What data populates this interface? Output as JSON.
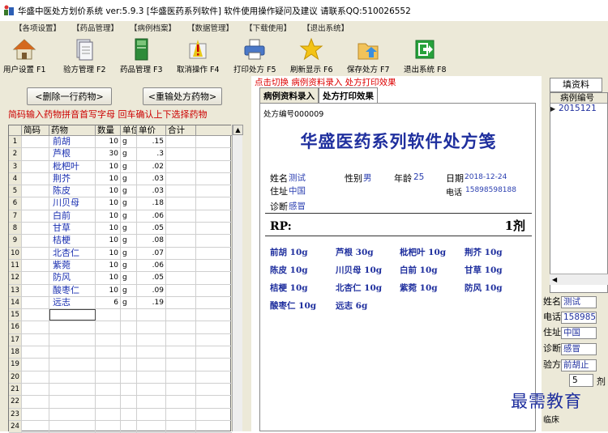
{
  "window": {
    "title": "华盛中医处方划价系统 ver:5.9.3 [华盛医药系列软件]   软件使用操作疑问及建议 请联系QQ:510026552"
  },
  "menu": [
    "【各项设置】",
    "【药品管理】",
    "【病例档案】",
    "【数据管理】",
    "【下载使用】",
    "【退出系统】"
  ],
  "toolbar": [
    {
      "label": "用户设置 F1",
      "icon": "home-icon"
    },
    {
      "label": "验方管理 F2",
      "icon": "document-icon"
    },
    {
      "label": "药品管理 F3",
      "icon": "book-icon"
    },
    {
      "label": "取消操作 F4",
      "icon": "warning-icon"
    },
    {
      "label": "打印处方 F5",
      "icon": "printer-icon"
    },
    {
      "label": "刷新显示 F6",
      "icon": "star-icon"
    },
    {
      "label": "保存处方 F7",
      "icon": "folder-icon"
    },
    {
      "label": "退出系统 F8",
      "icon": "exit-icon"
    }
  ],
  "hint": "点击切换 病例资料录入 处方打印效果",
  "left": {
    "delete_button": "<删除一行药物>",
    "reenter_button": "<重输处方药物>",
    "tip": "简码输入药物拼音首写字母  回车确认上下选择药物",
    "columns": [
      "简码",
      "药物",
      "数量",
      "单位",
      "单价",
      "合计"
    ],
    "rows": [
      {
        "n": "1",
        "code": "",
        "name": "前胡",
        "qty": "10",
        "unit": "g",
        "price": ".15",
        "total": ""
      },
      {
        "n": "2",
        "code": "",
        "name": "芦根",
        "qty": "30",
        "unit": "g",
        "price": ".3",
        "total": ""
      },
      {
        "n": "3",
        "code": "",
        "name": "枇杷叶",
        "qty": "10",
        "unit": "g",
        "price": ".02",
        "total": ""
      },
      {
        "n": "4",
        "code": "",
        "name": "荆芥",
        "qty": "10",
        "unit": "g",
        "price": ".03",
        "total": ""
      },
      {
        "n": "5",
        "code": "",
        "name": "陈皮",
        "qty": "10",
        "unit": "g",
        "price": ".03",
        "total": ""
      },
      {
        "n": "6",
        "code": "",
        "name": "川贝母",
        "qty": "10",
        "unit": "g",
        "price": ".18",
        "total": ""
      },
      {
        "n": "7",
        "code": "",
        "name": "白前",
        "qty": "10",
        "unit": "g",
        "price": ".06",
        "total": ""
      },
      {
        "n": "8",
        "code": "",
        "name": "甘草",
        "qty": "10",
        "unit": "g",
        "price": ".05",
        "total": ""
      },
      {
        "n": "9",
        "code": "",
        "name": "桔梗",
        "qty": "10",
        "unit": "g",
        "price": ".08",
        "total": ""
      },
      {
        "n": "10",
        "code": "",
        "name": "北杏仁",
        "qty": "10",
        "unit": "g",
        "price": ".07",
        "total": ""
      },
      {
        "n": "11",
        "code": "",
        "name": "紫菀",
        "qty": "10",
        "unit": "g",
        "price": ".06",
        "total": ""
      },
      {
        "n": "12",
        "code": "",
        "name": "防风",
        "qty": "10",
        "unit": "g",
        "price": ".05",
        "total": ""
      },
      {
        "n": "13",
        "code": "",
        "name": "酸枣仁",
        "qty": "10",
        "unit": "g",
        "price": ".09",
        "total": ""
      },
      {
        "n": "14",
        "code": "",
        "name": "远志",
        "qty": "6",
        "unit": "g",
        "price": ".19",
        "total": ""
      },
      {
        "n": "15",
        "code": "",
        "name": "",
        "qty": "",
        "unit": "",
        "price": "",
        "total": ""
      },
      {
        "n": "16",
        "code": "",
        "name": "",
        "qty": "",
        "unit": "",
        "price": "",
        "total": ""
      },
      {
        "n": "17",
        "code": "",
        "name": "",
        "qty": "",
        "unit": "",
        "price": "",
        "total": ""
      },
      {
        "n": "18",
        "code": "",
        "name": "",
        "qty": "",
        "unit": "",
        "price": "",
        "total": ""
      },
      {
        "n": "19",
        "code": "",
        "name": "",
        "qty": "",
        "unit": "",
        "price": "",
        "total": ""
      },
      {
        "n": "20",
        "code": "",
        "name": "",
        "qty": "",
        "unit": "",
        "price": "",
        "total": ""
      },
      {
        "n": "21",
        "code": "",
        "name": "",
        "qty": "",
        "unit": "",
        "price": "",
        "total": ""
      },
      {
        "n": "22",
        "code": "",
        "name": "",
        "qty": "",
        "unit": "",
        "price": "",
        "total": ""
      },
      {
        "n": "23",
        "code": "",
        "name": "",
        "qty": "",
        "unit": "",
        "price": "",
        "total": ""
      },
      {
        "n": "24",
        "code": "",
        "name": "",
        "qty": "",
        "unit": "",
        "price": "",
        "total": ""
      }
    ],
    "scroll_up": "▲"
  },
  "tabs": [
    "病例资料录入",
    "处方打印效果"
  ],
  "prescription": {
    "serial_label": "处方编号",
    "serial": "000009",
    "title": "华盛医药系列软件处方笺",
    "name_label": "姓名",
    "name": "测试",
    "sex_label": "性别",
    "sex": "男",
    "age_label": "年龄",
    "age": "25",
    "date_label": "日期",
    "date": "2018-12-24",
    "addr_label": "住址",
    "addr": "中国",
    "phone_label": "电话",
    "phone": "15898598188",
    "diag_label": "诊断",
    "diag": "感冒",
    "rp": "RP:",
    "doses": "1剂",
    "herbs": [
      "前胡 10g",
      "芦根 30g",
      "枇杷叶 10g",
      "荆芥 10g",
      "陈皮 10g",
      "川贝母 10g",
      "白前 10g",
      "甘草 10g",
      "桔梗 10g",
      "北杏仁 10g",
      "紫菀 10g",
      "防风 10g",
      "酸枣仁 10g",
      "远志 6g"
    ]
  },
  "right": {
    "tab": "填资料",
    "list_header": "病例编号",
    "list_row": "2015121",
    "scroll_left": "◀",
    "name_label": "姓名",
    "name": "测试",
    "phone_label": "电话",
    "phone": "158985",
    "addr_label": "住址",
    "addr": "中国",
    "diag_label": "诊断",
    "diag": "感冒",
    "formula_label": "验方",
    "formula": "前胡止",
    "doses": "5",
    "doses_unit": "剂",
    "clinic_label": "临床"
  },
  "watermark": "最需教育"
}
